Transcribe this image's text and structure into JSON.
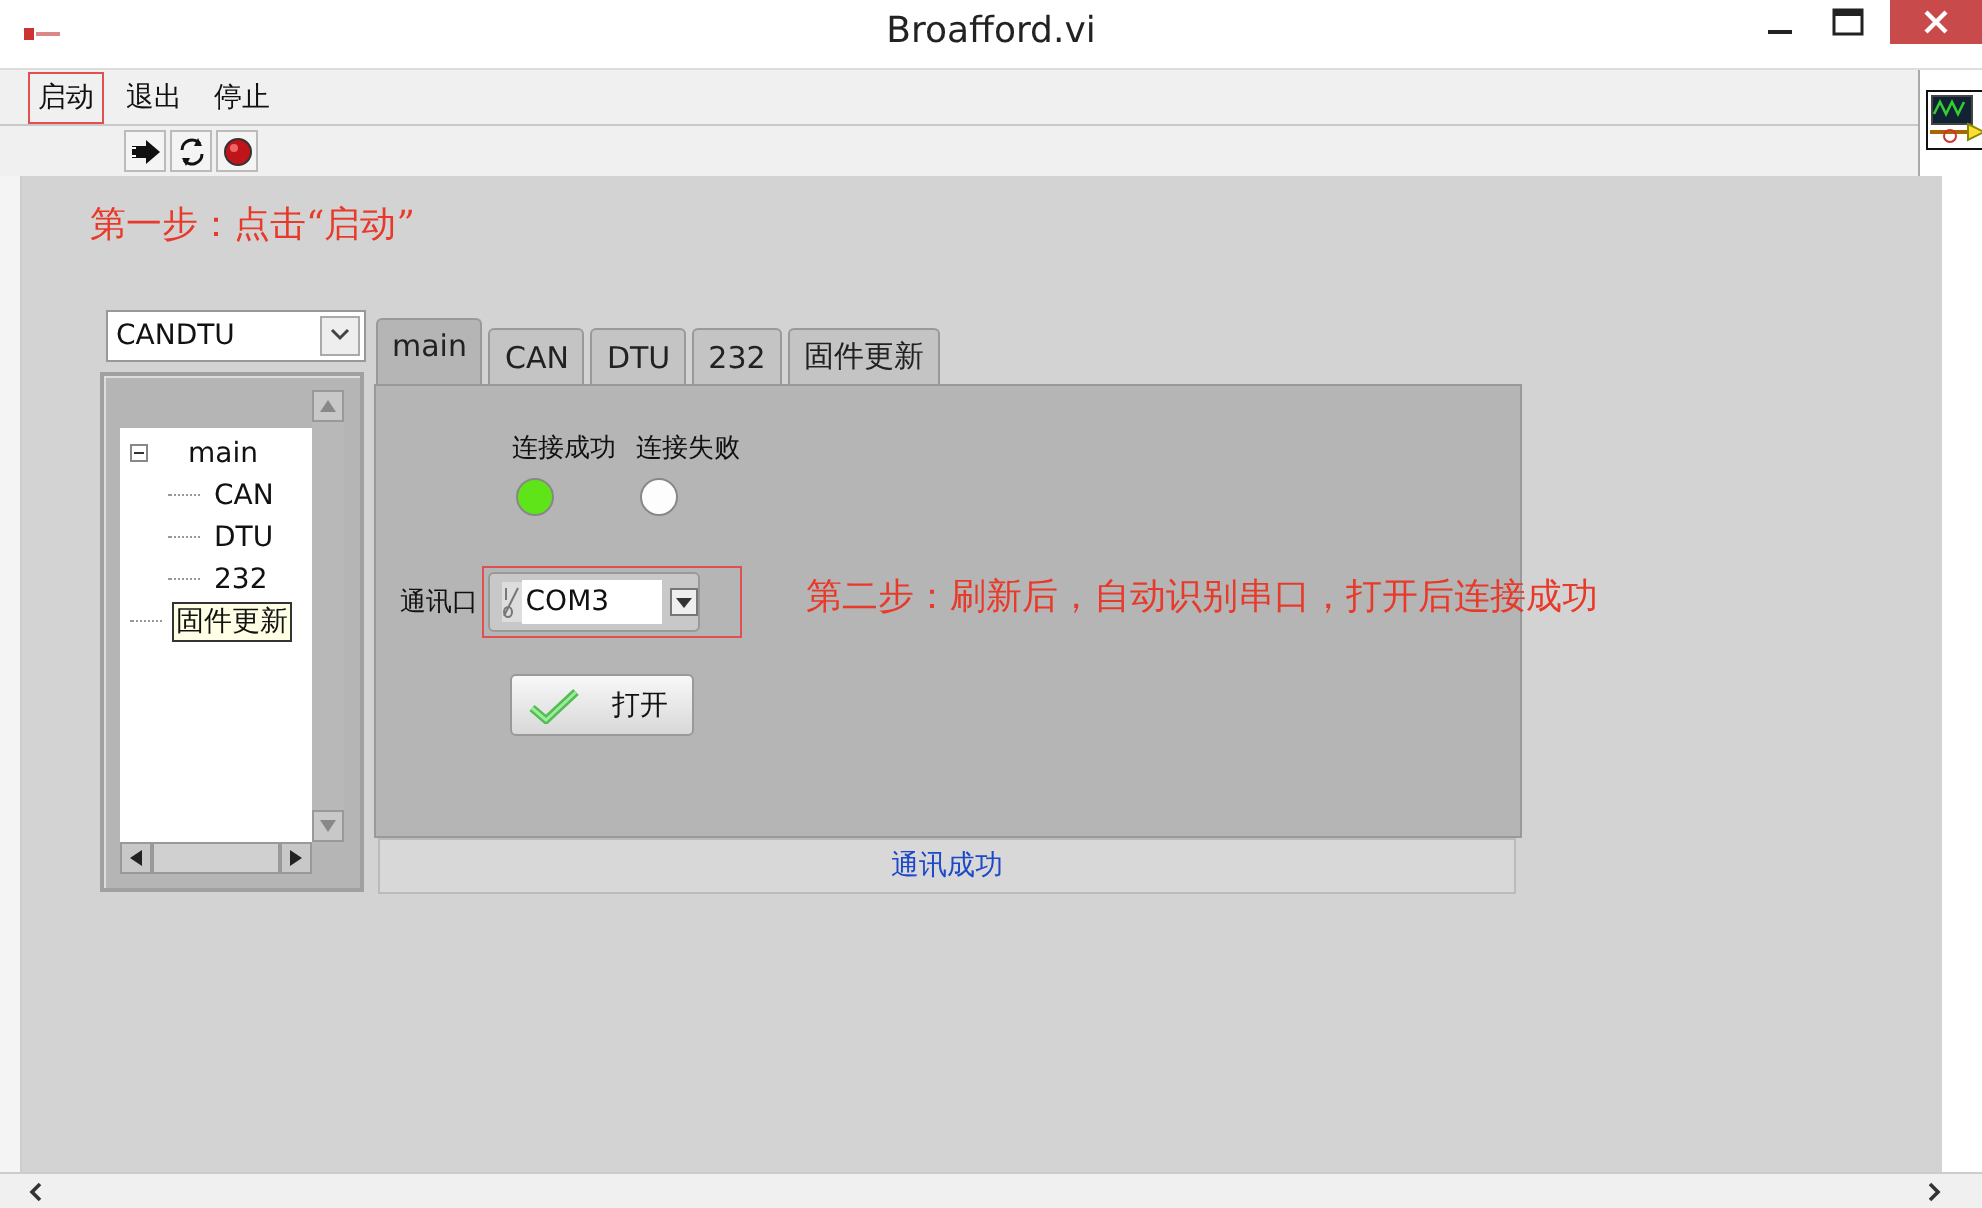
{
  "window": {
    "title": "Broafford.vi"
  },
  "menu": [
    {
      "label": "启动",
      "highlighted": true
    },
    {
      "label": "退出",
      "highlighted": false
    },
    {
      "label": "停止",
      "highlighted": false
    }
  ],
  "notes": [
    "第一步：点击“启动”",
    "第二步：刷新后，自动识别串口，打开后连接成功"
  ],
  "device_select": {
    "value": "CANDTU"
  },
  "tree": [
    {
      "label": "main",
      "expanded": true,
      "hovered": false,
      "children": [
        {
          "label": "CAN",
          "hovered": false
        },
        {
          "label": "DTU",
          "hovered": false
        },
        {
          "label": "232",
          "hovered": false
        }
      ]
    },
    {
      "label": "固件更新",
      "hovered": true
    }
  ],
  "tabs": [
    {
      "label": "main",
      "selected": true
    },
    {
      "label": "CAN",
      "selected": false
    },
    {
      "label": "DTU",
      "selected": false
    },
    {
      "label": "232",
      "selected": false
    },
    {
      "label": "固件更新",
      "selected": false
    }
  ],
  "leds": [
    {
      "label": "连接成功",
      "on": true
    },
    {
      "label": "连接失败",
      "on": false
    }
  ],
  "port": {
    "label": "通讯口",
    "value": "COM3",
    "highlighted": true
  },
  "open_button": {
    "label": "打开"
  },
  "status": "通讯成功"
}
